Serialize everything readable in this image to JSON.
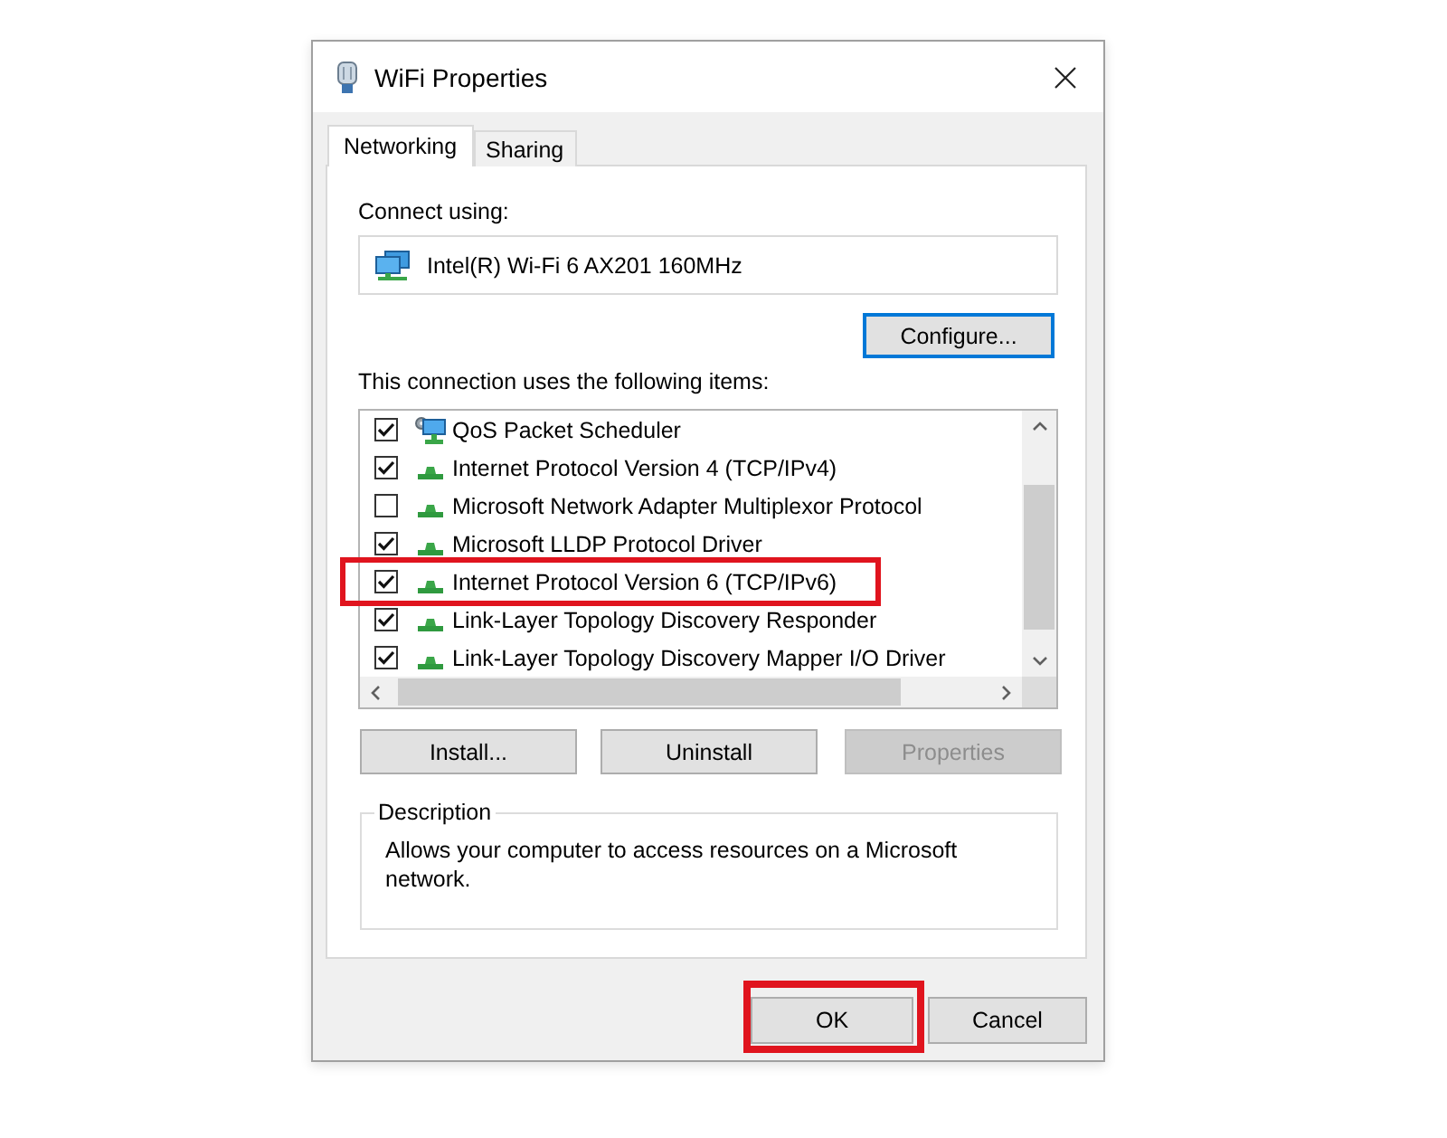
{
  "window": {
    "title": "WiFi Properties"
  },
  "tabs": [
    {
      "label": "Networking",
      "selected": true
    },
    {
      "label": "Sharing",
      "selected": false
    }
  ],
  "connect_using": {
    "label": "Connect using:",
    "adapter": "Intel(R) Wi-Fi 6 AX201 160MHz",
    "configure": {
      "label": "Configure...",
      "focused": true
    }
  },
  "items_list": {
    "label": "This connection uses the following items:",
    "items": [
      {
        "name": "QoS Packet Scheduler",
        "kind": "service",
        "checked": true,
        "highlighted": false
      },
      {
        "name": "Internet Protocol Version 4 (TCP/IPv4)",
        "kind": "protocol",
        "checked": true,
        "highlighted": false
      },
      {
        "name": "Microsoft Network Adapter Multiplexor Protocol",
        "kind": "protocol",
        "checked": false,
        "highlighted": false
      },
      {
        "name": "Microsoft LLDP Protocol Driver",
        "kind": "protocol",
        "checked": true,
        "highlighted": false
      },
      {
        "name": "Internet Protocol Version 6 (TCP/IPv6)",
        "kind": "protocol",
        "checked": true,
        "highlighted": true
      },
      {
        "name": "Link-Layer Topology Discovery Responder",
        "kind": "protocol",
        "checked": true,
        "highlighted": false
      },
      {
        "name": "Link-Layer Topology Discovery Mapper I/O Driver",
        "kind": "protocol",
        "checked": true,
        "highlighted": false
      }
    ]
  },
  "item_buttons": [
    {
      "label": "Install...",
      "disabled": false
    },
    {
      "label": "Uninstall",
      "disabled": false
    },
    {
      "label": "Properties",
      "disabled": true
    }
  ],
  "description": {
    "legend": "Description",
    "text": "Allows your computer to access resources on a Microsoft network."
  },
  "dialog_buttons": [
    {
      "label": "OK",
      "highlighted": true
    },
    {
      "label": "Cancel",
      "highlighted": false
    }
  ]
}
